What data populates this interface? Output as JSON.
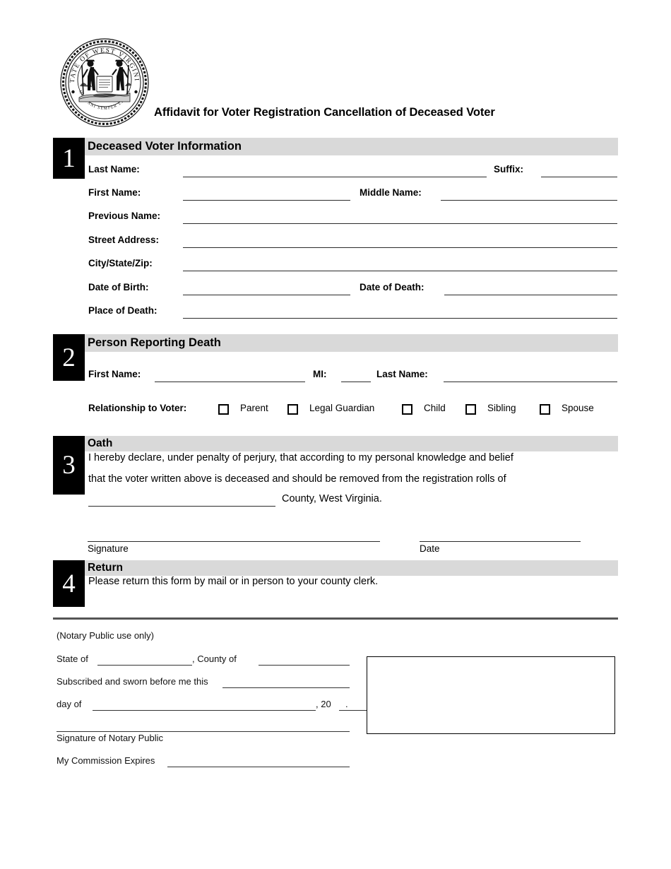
{
  "document": {
    "title": "Affidavit for Voter Registration Cancellation of Deceased Voter",
    "seal_name": "west-virginia-state-seal",
    "seal_top_text": "STATE OF WEST VIRGINIA",
    "seal_bottom_text": "MONTANI SEMPER LIBERI"
  },
  "colors": {
    "section_bar": "#d9d9d9",
    "number_box": "#000000",
    "rule": "#2b2b2b"
  },
  "sections": [
    {
      "number": "1",
      "heading": "Deceased Voter Information",
      "fields": [
        {
          "label": "Last Name:"
        },
        {
          "label": "Suffix:"
        },
        {
          "label": "First Name:"
        },
        {
          "label": "Middle Name:"
        },
        {
          "label": "Previous Name:"
        },
        {
          "label": "Street Address:"
        },
        {
          "label": "City/State/Zip:"
        },
        {
          "label": "Date of Birth:"
        },
        {
          "label": "Date of Death:"
        },
        {
          "label": "Place of Death:"
        }
      ]
    },
    {
      "number": "2",
      "heading": "Person Reporting Death",
      "fields": [
        {
          "label": "First Name:"
        },
        {
          "label": "MI:"
        },
        {
          "label": "Last Name:"
        }
      ],
      "relationship_label": "Relationship to Voter:",
      "relationship_options": [
        "Parent",
        "Legal Guardian",
        "Child",
        "Sibling",
        "Spouse"
      ]
    },
    {
      "number": "3",
      "heading": "Oath",
      "oath_line_1": "I hereby declare, under penalty of perjury, that according to my personal knowledge and belief",
      "oath_line_2": "that the voter written above is deceased and should be removed from the registration rolls of",
      "oath_line_3_suffix": "County, West Virginia.",
      "signature_label": "Signature",
      "date_label": "Date"
    },
    {
      "number": "4",
      "heading": "Return",
      "body": "Please return this form by mail or in person to your county clerk."
    }
  ],
  "notary": {
    "header": "(Notary Public use only)",
    "state_label": "State of",
    "county_label": ", County of",
    "sworn_label": "Subscribed and sworn before me this",
    "day_label": "day of",
    "year_prefix": ", 20",
    "year_suffix": ".",
    "signature_label": "Signature of Notary Public",
    "commission_label": "My Commission Expires"
  }
}
